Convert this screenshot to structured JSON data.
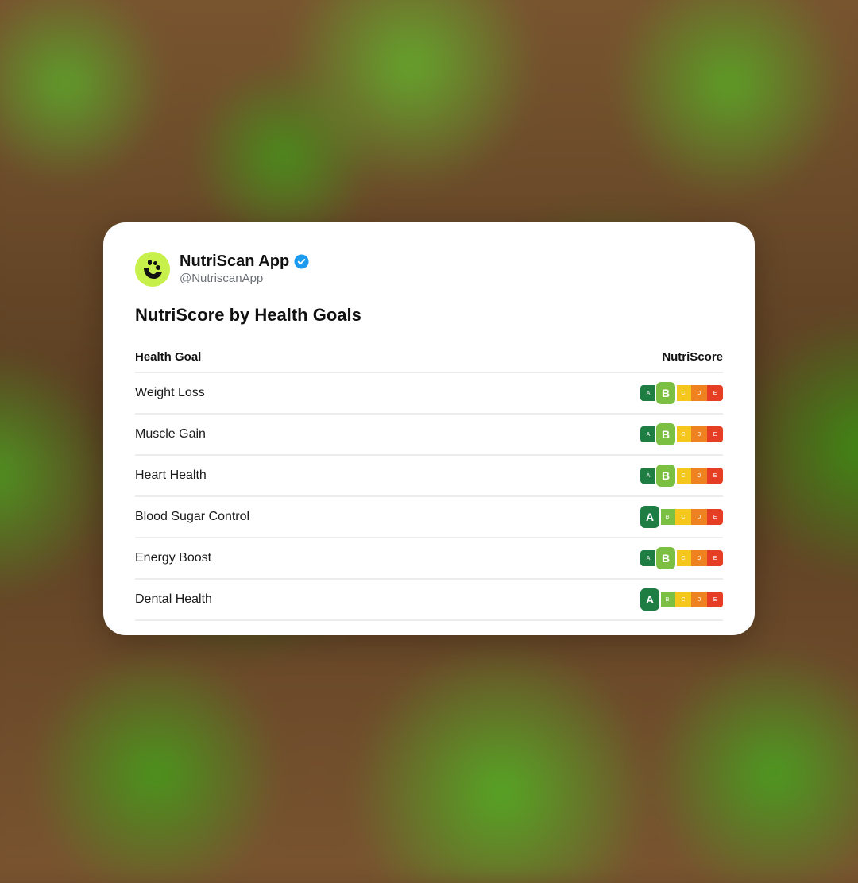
{
  "account": {
    "name": "NutriScan App",
    "handle": "@NutriscanApp"
  },
  "post": {
    "title": "NutriScore by Health Goals"
  },
  "table": {
    "headers": {
      "goal": "Health Goal",
      "score": "NutriScore"
    },
    "grades": [
      "A",
      "B",
      "C",
      "D",
      "E"
    ],
    "grade_colors": [
      "#1e7d42",
      "#7cc043",
      "#f5c61c",
      "#ee8221",
      "#e63e25"
    ],
    "rows": [
      {
        "goal": "Weight Loss",
        "score": "B"
      },
      {
        "goal": "Muscle Gain",
        "score": "B"
      },
      {
        "goal": "Heart Health",
        "score": "B"
      },
      {
        "goal": "Blood Sugar Control",
        "score": "A"
      },
      {
        "goal": "Energy Boost",
        "score": "B"
      },
      {
        "goal": "Dental Health",
        "score": "A"
      }
    ]
  }
}
